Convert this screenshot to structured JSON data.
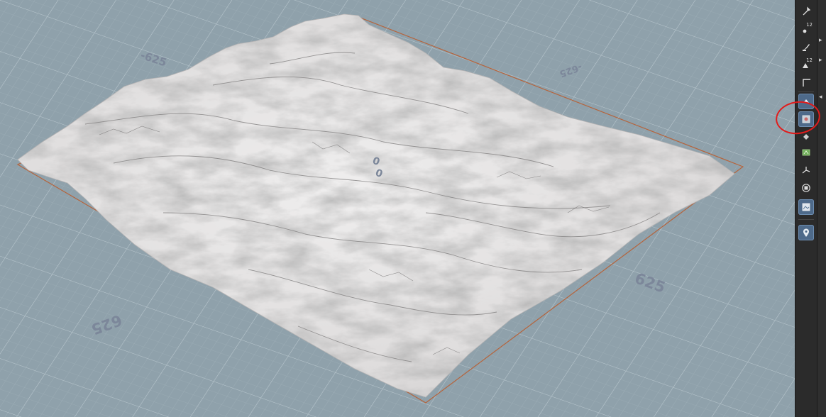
{
  "viewport": {
    "grid_labels": {
      "top_left": "-625",
      "top_right": "-625",
      "center_a": "0",
      "center_b": "0",
      "bottom_right": "625",
      "bottom_left": "625"
    },
    "colors": {
      "background": "#8fa1ab",
      "grid_line": "#a8b8c1",
      "terrain_light": "#ecebeb",
      "terrain_shadow": "#8a8a8a",
      "bounds_line": "#b5643c"
    }
  },
  "toolbar": {
    "items": [
      {
        "icon": "pin-icon",
        "label": "",
        "active": false
      },
      {
        "icon": "points-icon",
        "label": "12",
        "active": false
      },
      {
        "icon": "brush-icon",
        "label": "",
        "active": false
      },
      {
        "icon": "primitives-icon",
        "label": "12",
        "active": false
      },
      {
        "icon": "corner-icon",
        "label": "",
        "active": false
      },
      {
        "icon": "arrow-up-icon",
        "label": "",
        "active": true
      },
      {
        "icon": "display-mode-icon",
        "label": "",
        "active": true
      },
      {
        "icon": "diamond-icon",
        "label": "",
        "active": false
      },
      {
        "icon": "geometry-icon",
        "label": "",
        "active": false
      },
      {
        "icon": "axis-icon",
        "label": "",
        "active": false
      },
      {
        "icon": "square-icon",
        "label": "",
        "active": false
      },
      {
        "icon": "background-image-icon",
        "label": "",
        "active": true
      },
      {
        "icon": "location-pin-icon",
        "label": "",
        "active": true
      }
    ],
    "highlight_color": "#e11c1c"
  }
}
